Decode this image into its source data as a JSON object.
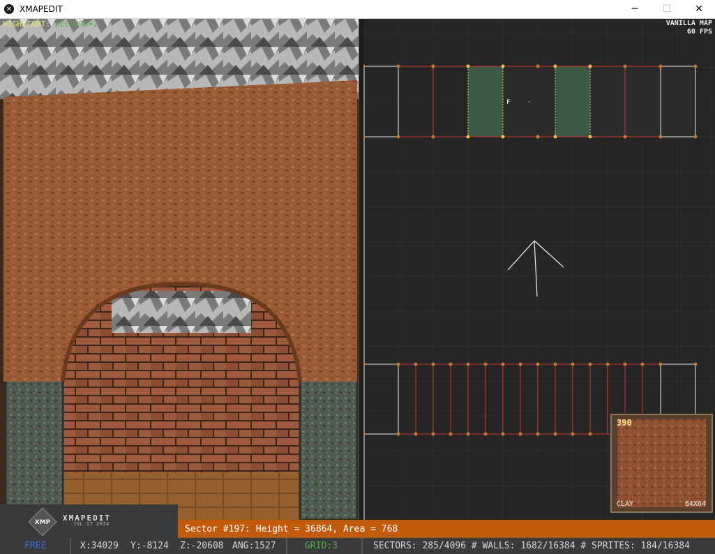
{
  "window": {
    "title": "XMAPEDIT",
    "min_icon": "minimize-icon",
    "max_icon": "maximize-icon",
    "close_icon": "close-icon"
  },
  "view3d": {
    "highlight_label": "HIGHLIGHT:",
    "highlight_value": "SECTORS=2"
  },
  "map2d": {
    "map_label": "VANILLA MAP",
    "fps": "60 FPS",
    "sprite_marker": "F"
  },
  "texture_preview": {
    "number": "390",
    "name": "CLAY",
    "size": "64X64"
  },
  "logo": {
    "brand": "XMAPEDIT",
    "date": "JUL 17 2024",
    "badge": "XMP"
  },
  "info": {
    "text": "Sector #197: Height = 36864, Area = 768"
  },
  "status": {
    "mode": "FREE",
    "x": "X:34029",
    "y": "Y:-8124",
    "z": "Z:-20608",
    "ang": "ANG:1527",
    "grid": "GRID:3",
    "counts": "SECTORS: 285/4096 # WALLS: 1682/16384 # SPRITES: 184/16384"
  },
  "colors": {
    "status_bg": "#3b3b3b",
    "info_bg": "#c25a0c",
    "mode": "#3c6dd8",
    "grid": "#4bb04b",
    "highlight": "#e8e86a",
    "map_bg": "#262626"
  }
}
